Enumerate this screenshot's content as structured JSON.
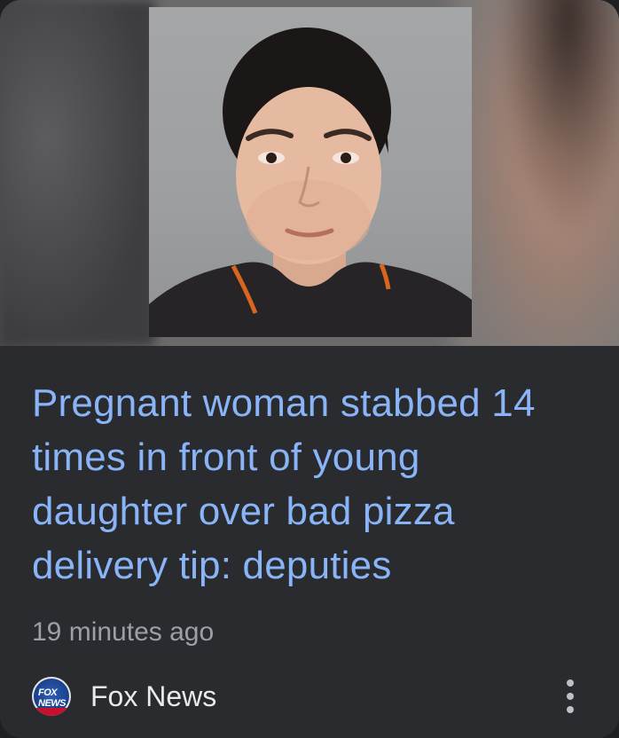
{
  "article": {
    "headline": "Pregnant woman stabbed 14 times in front of young daughter over bad pizza delivery tip: deputies",
    "timestamp": "19 minutes ago",
    "source": {
      "name": "Fox News",
      "logo_icon": "fox-news-logo-icon",
      "logo_text": "FOX NEWS"
    },
    "menu_icon": "more-vert-icon"
  },
  "colors": {
    "card_background": "#2a2b2e",
    "headline": "#8ab4f8",
    "timestamp": "#9aa0a6",
    "source_name": "#e8eaed"
  }
}
